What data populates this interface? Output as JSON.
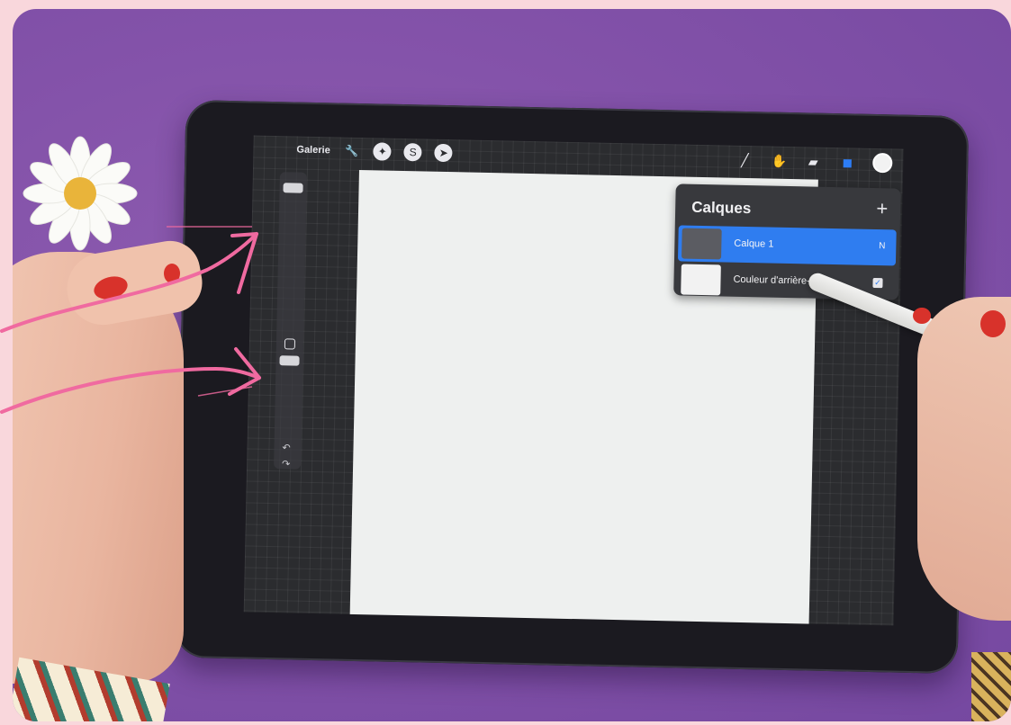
{
  "app": {
    "topbar": {
      "gallery_label": "Galerie"
    },
    "tools": {
      "actions_icon": "wrench-icon",
      "adjustments_icon": "magic-wand-icon",
      "selection_icon": "selection-s-icon",
      "transform_icon": "cursor-arrow-icon",
      "brush_icon": "brush-icon",
      "smudge_icon": "smudge-icon",
      "eraser_icon": "eraser-icon",
      "layers_icon": "layers-icon",
      "color_icon": "color-circle-icon"
    },
    "layers_panel": {
      "title": "Calques",
      "add_symbol": "+",
      "layers": [
        {
          "name": "Calque 1",
          "flag": "N",
          "thumb_color": "#5b5c62",
          "selected": true
        },
        {
          "name": "Couleur d'arrière-plan",
          "checked": true,
          "thumb_color": "#f2f2f2",
          "selected": false
        }
      ]
    },
    "sidebar": {
      "brush_size_level": 0.95,
      "opacity_level": 0.05,
      "undo_symbol": "↶",
      "redo_symbol": "↷"
    }
  },
  "colors": {
    "background_purple": "#8352a9",
    "accent_blue": "#2f7df0",
    "annotation_pink": "#f06aa0",
    "frame_pink": "#f9d7dc"
  }
}
